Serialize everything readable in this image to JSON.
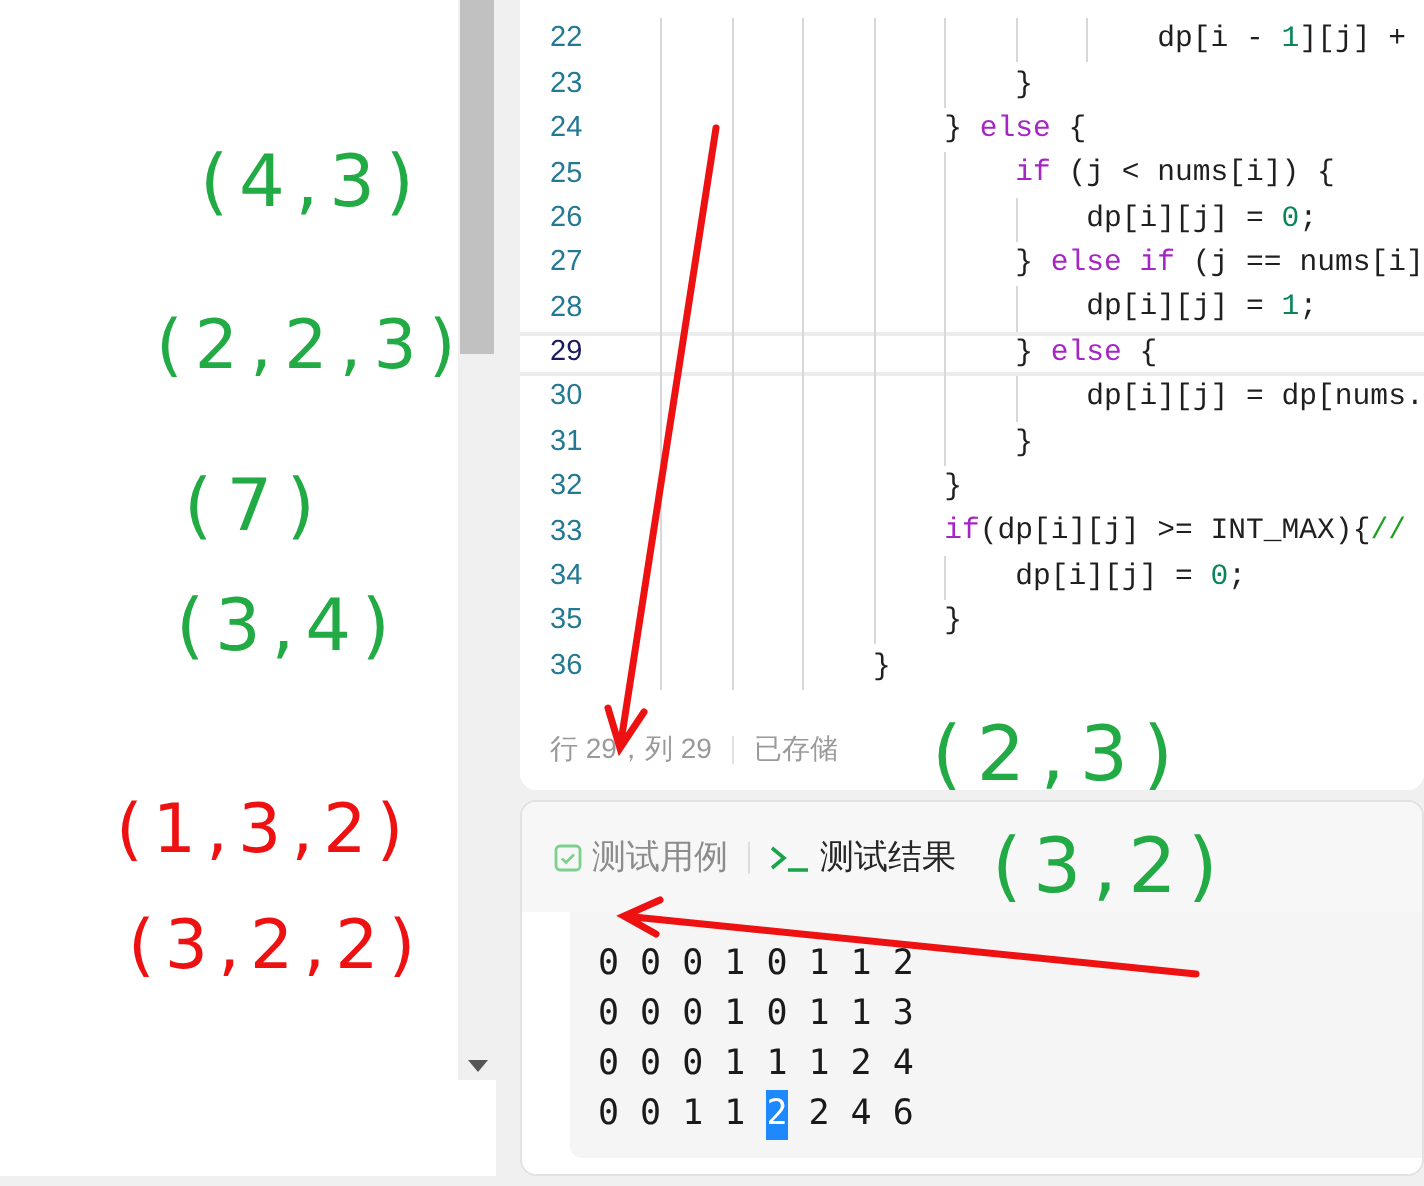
{
  "editor": {
    "lines": [
      {
        "number": "22",
        "current": false,
        "tokens": [
          {
            "kind": "plain",
            "text": "                            dp[i - "
          },
          {
            "kind": "number",
            "text": "1"
          },
          {
            "kind": "plain",
            "text": "][j] +"
          }
        ]
      },
      {
        "number": "23",
        "current": false,
        "tokens": [
          {
            "kind": "plain",
            "text": "                    }"
          }
        ]
      },
      {
        "number": "24",
        "current": false,
        "tokens": [
          {
            "kind": "plain",
            "text": "                } "
          },
          {
            "kind": "keyword",
            "text": "else"
          },
          {
            "kind": "plain",
            "text": " {"
          }
        ]
      },
      {
        "number": "25",
        "current": false,
        "tokens": [
          {
            "kind": "keyword",
            "text": "                    if"
          },
          {
            "kind": "plain",
            "text": " (j < nums[i]) {"
          }
        ]
      },
      {
        "number": "26",
        "current": false,
        "tokens": [
          {
            "kind": "plain",
            "text": "                        dp[i][j] = "
          },
          {
            "kind": "number",
            "text": "0"
          },
          {
            "kind": "plain",
            "text": ";"
          }
        ]
      },
      {
        "number": "27",
        "current": false,
        "tokens": [
          {
            "kind": "plain",
            "text": "                    } "
          },
          {
            "kind": "keyword",
            "text": "else if"
          },
          {
            "kind": "plain",
            "text": " (j == nums[i]"
          }
        ]
      },
      {
        "number": "28",
        "current": false,
        "tokens": [
          {
            "kind": "plain",
            "text": "                        dp[i][j] = "
          },
          {
            "kind": "number",
            "text": "1"
          },
          {
            "kind": "plain",
            "text": ";"
          }
        ]
      },
      {
        "number": "29",
        "current": true,
        "tokens": [
          {
            "kind": "plain",
            "text": "                    } "
          },
          {
            "kind": "keyword",
            "text": "else"
          },
          {
            "kind": "plain",
            "text": " {"
          }
        ]
      },
      {
        "number": "30",
        "current": false,
        "tokens": [
          {
            "kind": "plain",
            "text": "                        dp[i][j] = dp[nums."
          }
        ]
      },
      {
        "number": "31",
        "current": false,
        "tokens": [
          {
            "kind": "plain",
            "text": "                    }"
          }
        ]
      },
      {
        "number": "32",
        "current": false,
        "tokens": [
          {
            "kind": "plain",
            "text": "                }"
          }
        ]
      },
      {
        "number": "33",
        "current": false,
        "tokens": [
          {
            "kind": "keyword",
            "text": "                if"
          },
          {
            "kind": "plain",
            "text": "(dp[i][j] >= INT_MAX){"
          },
          {
            "kind": "comment",
            "text": "//"
          }
        ]
      },
      {
        "number": "34",
        "current": false,
        "tokens": [
          {
            "kind": "plain",
            "text": "                    dp[i][j] = "
          },
          {
            "kind": "number",
            "text": "0"
          },
          {
            "kind": "plain",
            "text": ";"
          }
        ]
      },
      {
        "number": "35",
        "current": false,
        "tokens": [
          {
            "kind": "plain",
            "text": "                }"
          }
        ]
      },
      {
        "number": "36",
        "current": false,
        "tokens": [
          {
            "kind": "plain",
            "text": "            }"
          }
        ]
      }
    ],
    "status": {
      "position": "行 29，列 29",
      "saved": "已存储"
    }
  },
  "bottom_panel": {
    "tabs": [
      {
        "label": "测试用例",
        "selected": false
      },
      {
        "label": "测试结果",
        "selected": true
      }
    ],
    "output": [
      [
        {
          "text": "0",
          "selected": false
        },
        {
          "text": "0",
          "selected": false
        },
        {
          "text": "0",
          "selected": false
        },
        {
          "text": "1",
          "selected": false
        },
        {
          "text": "0",
          "selected": false
        },
        {
          "text": "1",
          "selected": false
        },
        {
          "text": "1",
          "selected": false
        },
        {
          "text": "2",
          "selected": false
        }
      ],
      [
        {
          "text": "0",
          "selected": false
        },
        {
          "text": "0",
          "selected": false
        },
        {
          "text": "0",
          "selected": false
        },
        {
          "text": "1",
          "selected": false
        },
        {
          "text": "0",
          "selected": false
        },
        {
          "text": "1",
          "selected": false
        },
        {
          "text": "1",
          "selected": false
        },
        {
          "text": "3",
          "selected": false
        }
      ],
      [
        {
          "text": "0",
          "selected": false
        },
        {
          "text": "0",
          "selected": false
        },
        {
          "text": "0",
          "selected": false
        },
        {
          "text": "1",
          "selected": false
        },
        {
          "text": "1",
          "selected": false
        },
        {
          "text": "1",
          "selected": false
        },
        {
          "text": "2",
          "selected": false
        },
        {
          "text": "4",
          "selected": false
        }
      ],
      [
        {
          "text": "0",
          "selected": false
        },
        {
          "text": "0",
          "selected": false
        },
        {
          "text": "1",
          "selected": false
        },
        {
          "text": "1",
          "selected": false
        },
        {
          "text": "2",
          "selected": true
        },
        {
          "text": "2",
          "selected": false
        },
        {
          "text": "4",
          "selected": false
        },
        {
          "text": "6",
          "selected": false
        }
      ]
    ]
  },
  "annotations": [
    {
      "text": "(4,3)",
      "color": "#22aa44"
    },
    {
      "text": "(2,2,3)",
      "color": "#22aa44"
    },
    {
      "text": "(7)",
      "color": "#22aa44"
    },
    {
      "text": "(3,4)",
      "color": "#22aa44"
    },
    {
      "text": "(2,3)",
      "color": "#22aa44"
    },
    {
      "text": "(1,3,2)",
      "color": "#ee1111"
    },
    {
      "text": "(3,2)",
      "color": "#22aa44"
    },
    {
      "text": "(3,2,2)",
      "color": "#ee1111"
    }
  ]
}
